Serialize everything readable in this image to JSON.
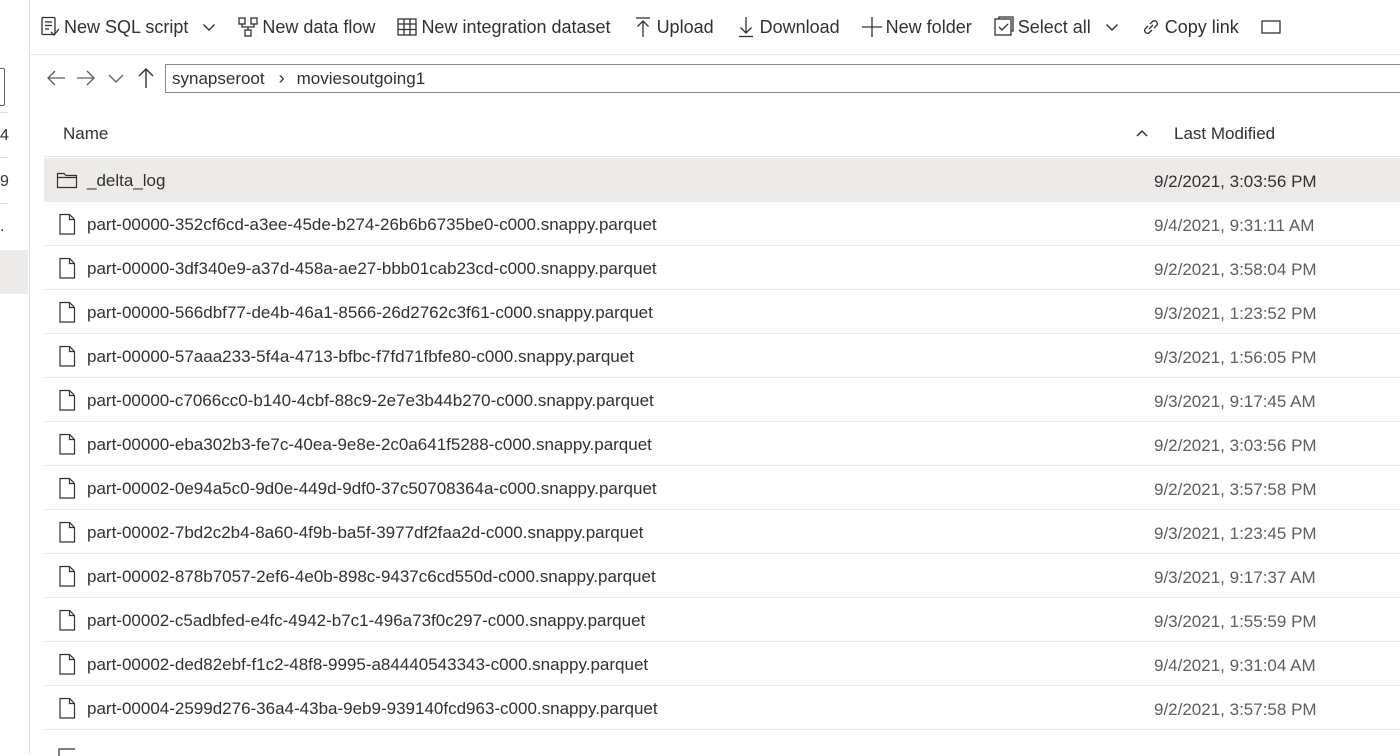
{
  "sidebar_fragments": [
    "4",
    "9",
    "."
  ],
  "toolbar": {
    "new_sql_script": "New SQL script",
    "new_data_flow": "New data flow",
    "new_integration_dataset": "New integration dataset",
    "upload": "Upload",
    "download": "Download",
    "new_folder": "New folder",
    "select_all": "Select all",
    "copy_link": "Copy link"
  },
  "breadcrumb": [
    "synapseroot",
    "moviesoutgoing1"
  ],
  "columns": {
    "name": "Name",
    "last_modified": "Last Modified"
  },
  "rows": [
    {
      "type": "folder",
      "name": "_delta_log",
      "modified": "9/2/2021, 3:03:56 PM",
      "selected": true
    },
    {
      "type": "file",
      "name": "part-00000-352cf6cd-a3ee-45de-b274-26b6b6735be0-c000.snappy.parquet",
      "modified": "9/4/2021, 9:31:11 AM"
    },
    {
      "type": "file",
      "name": "part-00000-3df340e9-a37d-458a-ae27-bbb01cab23cd-c000.snappy.parquet",
      "modified": "9/2/2021, 3:58:04 PM"
    },
    {
      "type": "file",
      "name": "part-00000-566dbf77-de4b-46a1-8566-26d2762c3f61-c000.snappy.parquet",
      "modified": "9/3/2021, 1:23:52 PM"
    },
    {
      "type": "file",
      "name": "part-00000-57aaa233-5f4a-4713-bfbc-f7fd71fbfe80-c000.snappy.parquet",
      "modified": "9/3/2021, 1:56:05 PM"
    },
    {
      "type": "file",
      "name": "part-00000-c7066cc0-b140-4cbf-88c9-2e7e3b44b270-c000.snappy.parquet",
      "modified": "9/3/2021, 9:17:45 AM"
    },
    {
      "type": "file",
      "name": "part-00000-eba302b3-fe7c-40ea-9e8e-2c0a641f5288-c000.snappy.parquet",
      "modified": "9/2/2021, 3:03:56 PM"
    },
    {
      "type": "file",
      "name": "part-00002-0e94a5c0-9d0e-449d-9df0-37c50708364a-c000.snappy.parquet",
      "modified": "9/2/2021, 3:57:58 PM"
    },
    {
      "type": "file",
      "name": "part-00002-7bd2c2b4-8a60-4f9b-ba5f-3977df2faa2d-c000.snappy.parquet",
      "modified": "9/3/2021, 1:23:45 PM"
    },
    {
      "type": "file",
      "name": "part-00002-878b7057-2ef6-4e0b-898c-9437c6cd550d-c000.snappy.parquet",
      "modified": "9/3/2021, 9:17:37 AM"
    },
    {
      "type": "file",
      "name": "part-00002-c5adbfed-e4fc-4942-b7c1-496a73f0c297-c000.snappy.parquet",
      "modified": "9/3/2021, 1:55:59 PM"
    },
    {
      "type": "file",
      "name": "part-00002-ded82ebf-f1c2-48f8-9995-a84440543343-c000.snappy.parquet",
      "modified": "9/4/2021, 9:31:04 AM"
    },
    {
      "type": "file",
      "name": "part-00004-2599d276-36a4-43ba-9eb9-939140fcd963-c000.snappy.parquet",
      "modified": "9/2/2021, 3:57:58 PM"
    }
  ]
}
